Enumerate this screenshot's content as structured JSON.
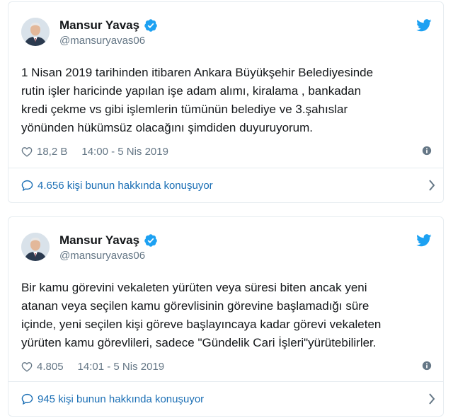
{
  "tweets": [
    {
      "author_name": "Mansur Yavaş",
      "handle": "@mansuryavas06",
      "text_lines": [
        "1 Nisan 2019 tarihinden itibaren Ankara Büyükşehir Belediyesinde",
        "rutin işler haricinde yapılan işe adam alımı, kiralama , bankadan",
        "kredi çekme vs gibi işlemlerin tümünün belediye ve 3.şahıslar",
        "yönünden hükümsüz olacağını şimdiden duyuruyorum."
      ],
      "likes": "18,2 B",
      "timestamp": "14:00 - 5 Nis 2019",
      "conversation": "4.656 kişi bunun hakkında konuşuyor"
    },
    {
      "author_name": "Mansur Yavaş",
      "handle": "@mansuryavas06",
      "text_lines": [
        "Bir kamu görevini vekaleten yürüten veya süresi biten ancak yeni",
        "atanan veya seçilen kamu görevlisinin görevine başlamadığı süre",
        "içinde, yeni seçilen kişi göreve başlayıncaya kadar görevi vekaleten",
        "yürüten kamu görevlileri, sadece \"Gündelik Cari İşleri\"yürütebilirler."
      ],
      "likes": "4.805",
      "timestamp": "14:01 - 5 Nis 2019",
      "conversation": "945 kişi bunun hakkında konuşuyor"
    }
  ],
  "icons": {
    "verified": "verified-badge-icon",
    "brand": "twitter-bird-icon",
    "like": "heart-icon",
    "info": "info-icon",
    "reply": "speech-bubble-icon",
    "more": "chevron-right-icon"
  },
  "colors": {
    "twitter_blue": "#1da1f2",
    "link_blue": "#1b6fb5",
    "secondary_text": "#657786",
    "border": "#e6ecf0"
  }
}
